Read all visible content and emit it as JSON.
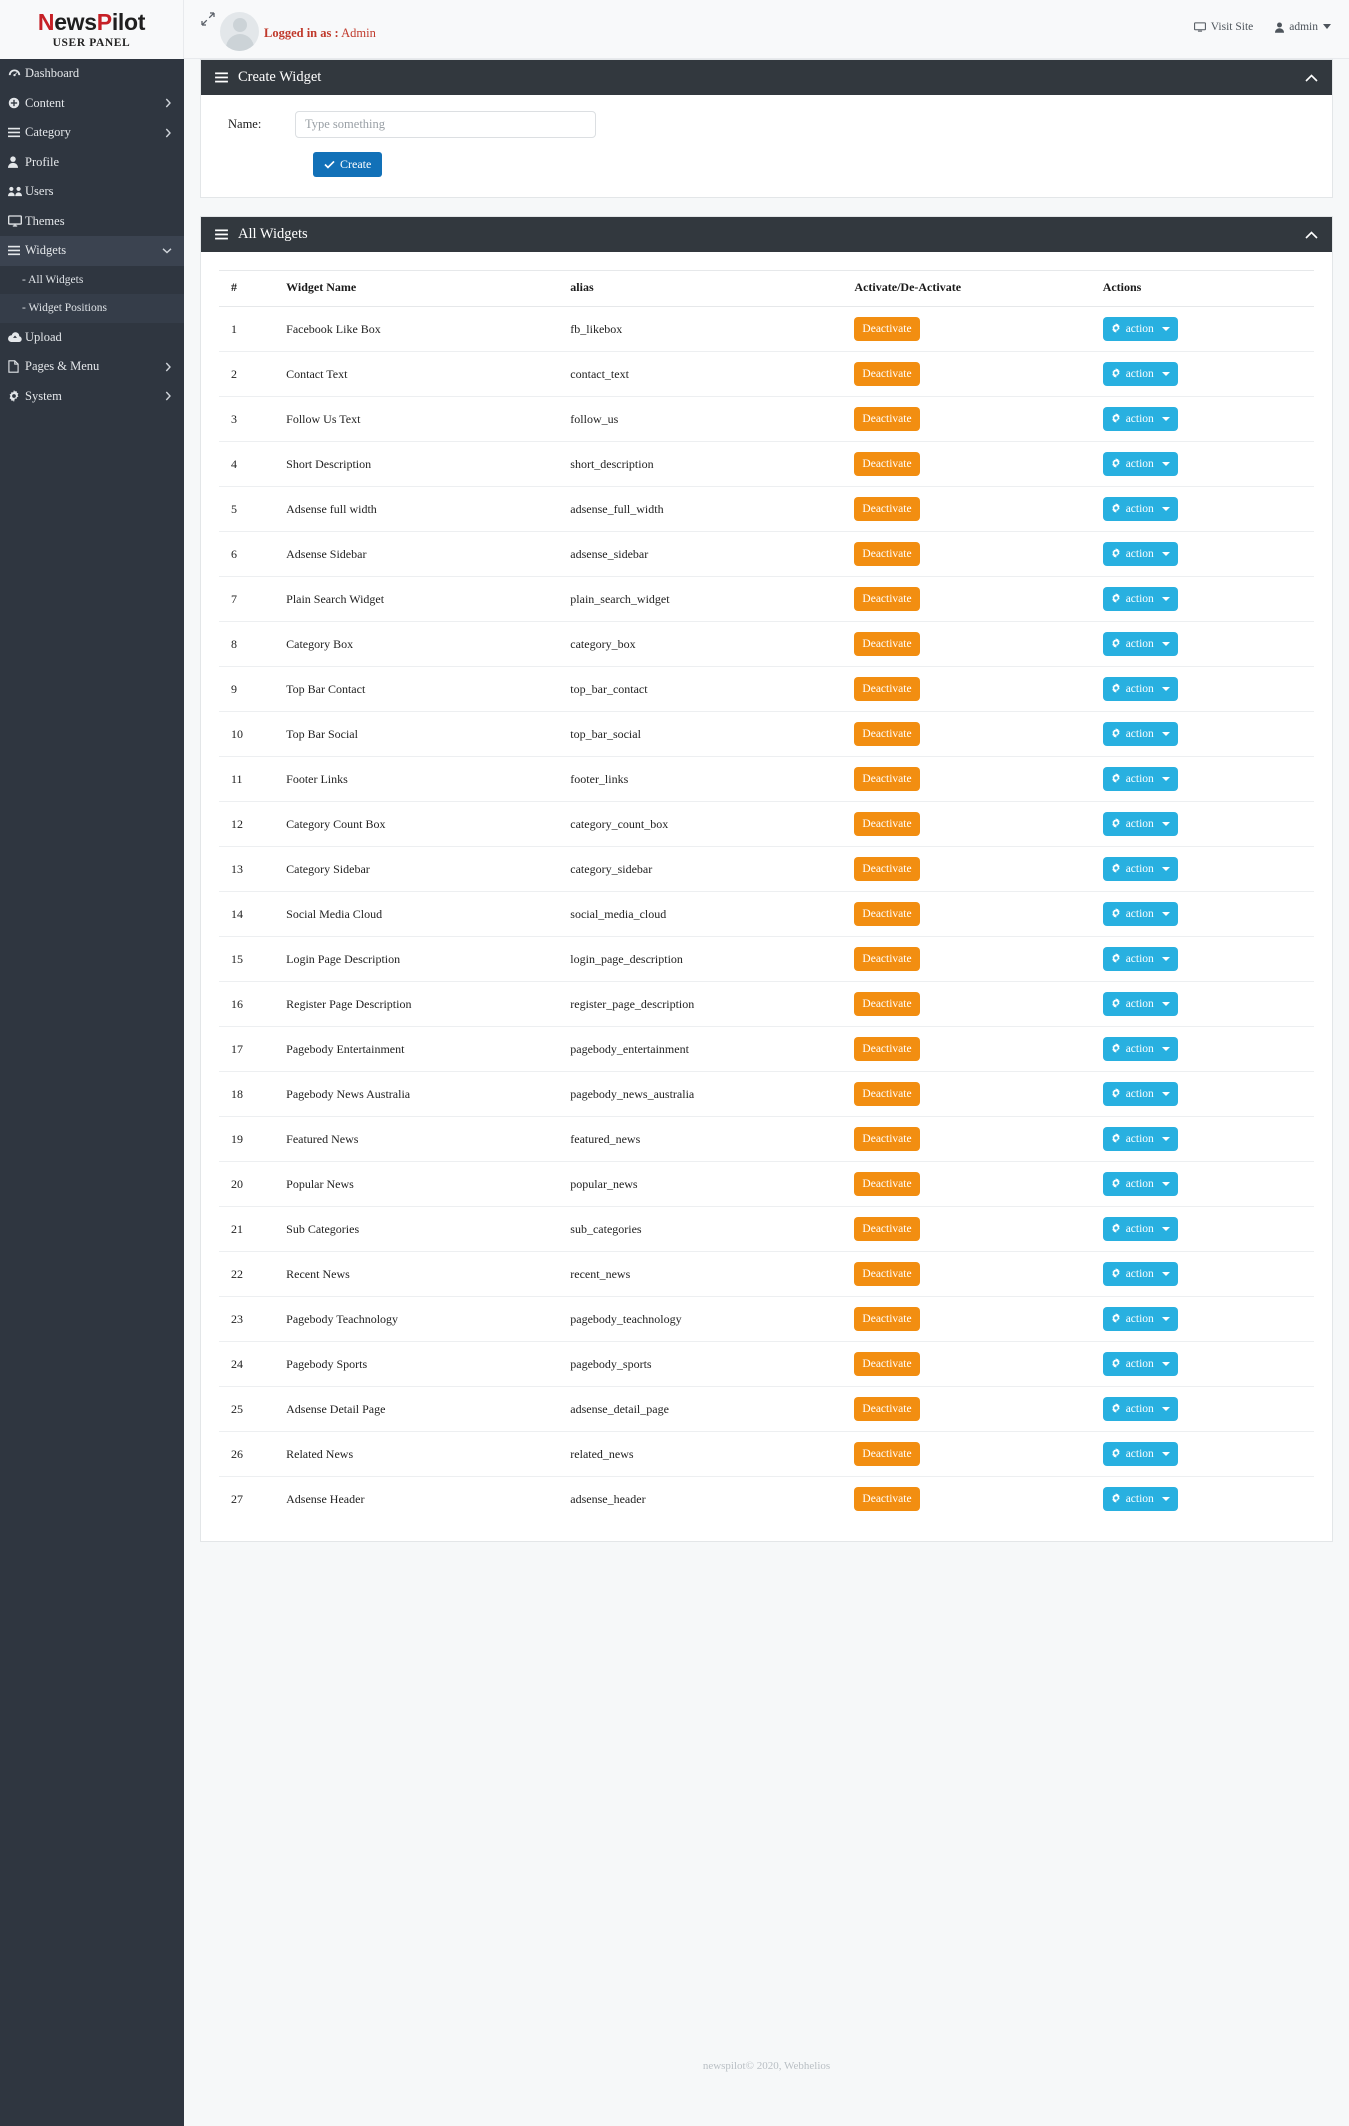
{
  "brand": {
    "logo_part1": "News",
    "logo_part2": "P",
    "logo_part3": "ilot",
    "logo_n": "N",
    "logo_ews": "ews",
    "subtitle": "USER PANEL"
  },
  "topbar": {
    "logged_in_label": "Logged in as :",
    "logged_in_user": "Admin",
    "visit_site": "Visit Site",
    "admin": "admin"
  },
  "sidebar": {
    "items": [
      {
        "label": "Dashboard",
        "icon": "dashboard-icon",
        "has_caret": false,
        "active": false
      },
      {
        "label": "Content",
        "icon": "plus-circle-icon",
        "has_caret": true,
        "active": false
      },
      {
        "label": "Category",
        "icon": "bars-icon",
        "has_caret": true,
        "active": false
      },
      {
        "label": "Profile",
        "icon": "user-icon",
        "has_caret": false,
        "active": false
      },
      {
        "label": "Users",
        "icon": "users-icon",
        "has_caret": false,
        "active": false
      },
      {
        "label": "Themes",
        "icon": "desktop-icon",
        "has_caret": false,
        "active": false
      },
      {
        "label": "Widgets",
        "icon": "bars-icon",
        "has_caret": true,
        "active": true
      },
      {
        "label": "Upload",
        "icon": "cloud-upload-icon",
        "has_caret": false,
        "active": false
      },
      {
        "label": "Pages & Menu",
        "icon": "file-icon",
        "has_caret": true,
        "active": false
      },
      {
        "label": "System",
        "icon": "gear-icon",
        "has_caret": true,
        "active": false
      }
    ],
    "sub_items": [
      {
        "label": "- All Widgets",
        "active": false
      },
      {
        "label": "- Widget Positions",
        "active": true
      }
    ]
  },
  "create_panel": {
    "title": "Create Widget",
    "name_label": "Name:",
    "name_value": "",
    "name_placeholder": "Type something",
    "create_button": "Create"
  },
  "widgets_panel": {
    "title": "All Widgets",
    "columns": [
      "#",
      "Widget Name",
      "alias",
      "Activate/De-Activate",
      "Actions"
    ],
    "deactivate_label": "Deactivate",
    "action_label": "action",
    "rows": [
      {
        "num": "1",
        "name": "Facebook Like Box",
        "alias": "fb_likebox"
      },
      {
        "num": "2",
        "name": "Contact Text",
        "alias": "contact_text"
      },
      {
        "num": "3",
        "name": "Follow Us Text",
        "alias": "follow_us"
      },
      {
        "num": "4",
        "name": "Short Description",
        "alias": "short_description"
      },
      {
        "num": "5",
        "name": "Adsense full width",
        "alias": "adsense_full_width"
      },
      {
        "num": "6",
        "name": "Adsense Sidebar",
        "alias": "adsense_sidebar"
      },
      {
        "num": "7",
        "name": "Plain Search Widget",
        "alias": "plain_search_widget"
      },
      {
        "num": "8",
        "name": "Category Box",
        "alias": "category_box"
      },
      {
        "num": "9",
        "name": "Top Bar Contact",
        "alias": "top_bar_contact"
      },
      {
        "num": "10",
        "name": "Top Bar Social",
        "alias": "top_bar_social"
      },
      {
        "num": "11",
        "name": "Footer Links",
        "alias": "footer_links"
      },
      {
        "num": "12",
        "name": "Category Count Box",
        "alias": "category_count_box"
      },
      {
        "num": "13",
        "name": "Category Sidebar",
        "alias": "category_sidebar"
      },
      {
        "num": "14",
        "name": "Social Media Cloud",
        "alias": "social_media_cloud"
      },
      {
        "num": "15",
        "name": "Login Page Description",
        "alias": "login_page_description"
      },
      {
        "num": "16",
        "name": "Register Page Description",
        "alias": "register_page_description"
      },
      {
        "num": "17",
        "name": "Pagebody Entertainment",
        "alias": "pagebody_entertainment"
      },
      {
        "num": "18",
        "name": "Pagebody News Australia",
        "alias": "pagebody_news_australia"
      },
      {
        "num": "19",
        "name": "Featured News",
        "alias": "featured_news"
      },
      {
        "num": "20",
        "name": "Popular News",
        "alias": "popular_news"
      },
      {
        "num": "21",
        "name": "Sub Categories",
        "alias": "sub_categories"
      },
      {
        "num": "22",
        "name": "Recent News",
        "alias": "recent_news"
      },
      {
        "num": "23",
        "name": "Pagebody Teachnology",
        "alias": "pagebody_teachnology"
      },
      {
        "num": "24",
        "name": "Pagebody Sports",
        "alias": "pagebody_sports"
      },
      {
        "num": "25",
        "name": "Adsense Detail Page",
        "alias": "adsense_detail_page"
      },
      {
        "num": "26",
        "name": "Related News",
        "alias": "related_news"
      },
      {
        "num": "27",
        "name": "Adsense Header",
        "alias": "adsense_header"
      }
    ]
  },
  "footer": {
    "text": "newspilot© 2020, Webhelios"
  },
  "colors": {
    "sidebar_bg": "#2f3640",
    "panel_head_bg": "#32383e",
    "accent_blue": "#1271b8",
    "deactivate_orange": "#f28e11",
    "action_cyan": "#28b0e0",
    "logged_in_red": "#c0392b",
    "brand_red": "#c62026"
  }
}
